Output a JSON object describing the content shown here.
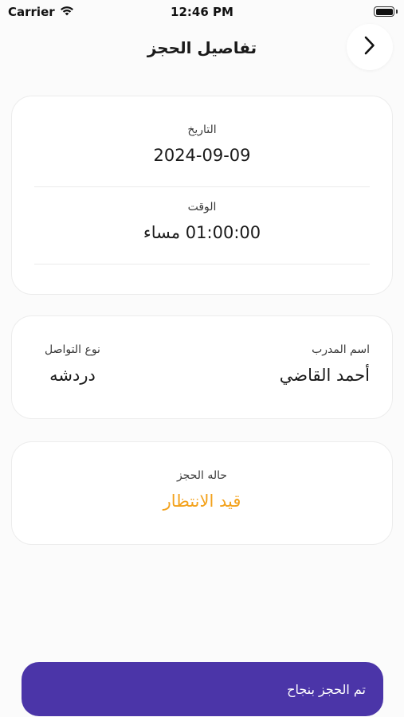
{
  "status_bar": {
    "carrier": "Carrier",
    "time": "12:46 PM",
    "icons": [
      "wifi-icon",
      "battery-icon"
    ]
  },
  "header": {
    "title": "تفاصيل الحجز",
    "back_icon": "chevron-right-icon"
  },
  "datetime_card": {
    "date_label": "التاريخ",
    "date_value": "2024-09-09",
    "time_label": "الوقت",
    "time_value": "01:00:00 مساء"
  },
  "trainer_card": {
    "trainer_label": "اسم المدرب",
    "trainer_value": "أحمد القاضي",
    "contact_type_label": "نوع التواصل",
    "contact_type_value": "دردشه"
  },
  "status_card": {
    "status_label": "حاله الحجز",
    "status_value": "قيد الانتظار"
  },
  "footer": {
    "confirm_label": "تم الحجز بنجاح"
  },
  "colors": {
    "accent": "#4b35a8",
    "status_pending": "#f3a21c",
    "background": "#fbfbfb",
    "card": "#ffffff"
  }
}
